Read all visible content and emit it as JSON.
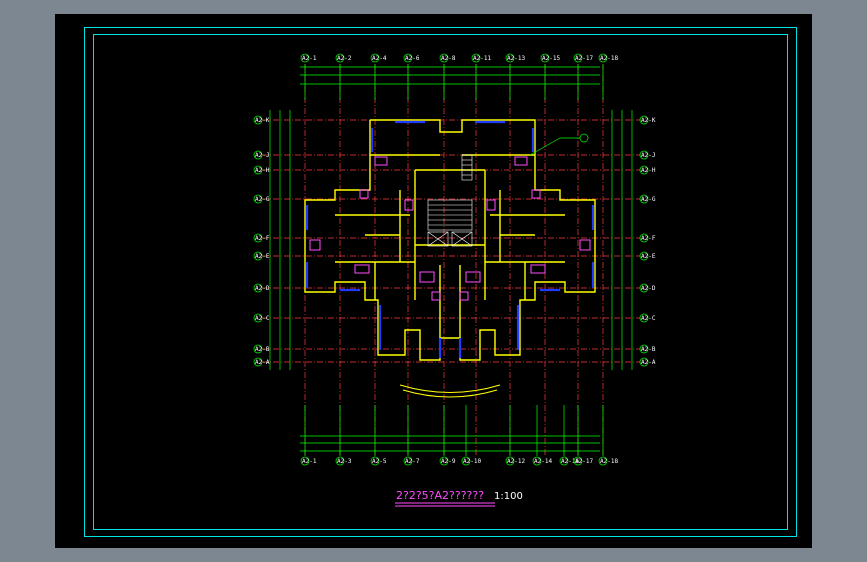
{
  "colors": {
    "background": "#7d8791",
    "sheet": "#000000",
    "frame": "#00e5e5",
    "grid": "#ff3b3b",
    "dimension": "#00ff00",
    "wall": "#ffff00",
    "window": "#1f3bff",
    "fixture": "#ff4dff",
    "text": "#ffffff"
  },
  "axes_top": [
    "A2-1",
    "A2-2",
    "A2-4",
    "A2-6",
    "A2-8",
    "A2-11",
    "A2-13",
    "A2-15",
    "A2-17",
    "A2-18"
  ],
  "axes_bottom": [
    "A2-1",
    "A2-3",
    "A2-5",
    "A2-7",
    "A2-9",
    "A2-10",
    "A2-12",
    "A2-14",
    "A2-16",
    "A2-17",
    "A2-18"
  ],
  "axes_left": [
    "A2-K",
    "A2-J",
    "A2-H",
    "A2-G",
    "A2-F",
    "A2-E",
    "A2-D",
    "A2-C",
    "A2-B",
    "A2-A"
  ],
  "axes_right": [
    "A2-K",
    "A2-J",
    "A2-H",
    "A2-G",
    "A2-F",
    "A2-E",
    "A2-D",
    "A2-C",
    "A2-B",
    "A2-A"
  ],
  "title": {
    "text": "2?2?5?A2??????",
    "scale": "1:100"
  }
}
